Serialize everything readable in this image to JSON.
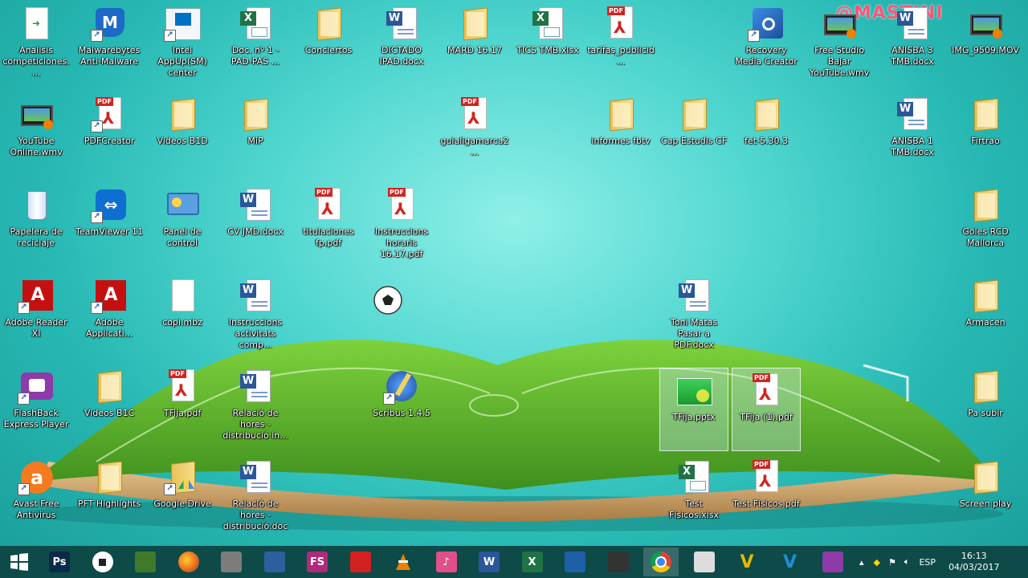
{
  "watermark": "@MASTINI",
  "desktop_icons": [
    {
      "label": "Analisis competiciones....",
      "type": "doc-generic"
    },
    {
      "label": "Malwarebytes Anti-Malware",
      "type": "malwarebytes"
    },
    {
      "label": "Intel AppUp(SM) center",
      "type": "intel"
    },
    {
      "label": "Doc. nº 1 - PAD-PAS ...",
      "type": "excel"
    },
    {
      "label": "Conciertos",
      "type": "folder"
    },
    {
      "label": "DICTADO IPAD.docx",
      "type": "word"
    },
    {
      "label": "MARD 16.17",
      "type": "folder"
    },
    {
      "label": "TICS TMB.xlsx",
      "type": "excel"
    },
    {
      "label": "tarifas_publicid...",
      "type": "pdf"
    },
    {
      "label": "Recovery Media Creator",
      "type": "recovery"
    },
    {
      "label": "Free Studio Bajar YouTube.wmv",
      "type": "video"
    },
    {
      "label": "ANISBA 3 TMB.docx",
      "type": "word"
    },
    {
      "label": "IMG_9509.MOV",
      "type": "video"
    },
    {
      "label": "YouTube Online.wmv",
      "type": "video"
    },
    {
      "label": "PDFCreator",
      "type": "pdfcreator"
    },
    {
      "label": "Videos B1D",
      "type": "folder"
    },
    {
      "label": "MiP",
      "type": "folder"
    },
    {
      "label": "guialigamarca2...",
      "type": "pdf"
    },
    {
      "label": "informes fbtv",
      "type": "folder"
    },
    {
      "label": "Cap Estudis CF",
      "type": "folder"
    },
    {
      "label": "fet-5.30.3",
      "type": "folder"
    },
    {
      "label": "ANISBA 1 TMB.docx",
      "type": "word"
    },
    {
      "label": "Firtrao",
      "type": "folder"
    },
    {
      "label": "Papelera de reciclaje",
      "type": "recycle"
    },
    {
      "label": "TeamViewer 11",
      "type": "teamviewer"
    },
    {
      "label": "Panel de control",
      "type": "control"
    },
    {
      "label": "CV JMD.docx",
      "type": "word"
    },
    {
      "label": "titulaciones fp.pdf",
      "type": "pdf"
    },
    {
      "label": "Instruccions horaris 16.17.pdf",
      "type": "pdf"
    },
    {
      "label": "Goles RCD Mallorca",
      "type": "folder"
    },
    {
      "label": "Adobe Reader XI",
      "type": "adobe"
    },
    {
      "label": "Adobe Applicati...",
      "type": "adobe"
    },
    {
      "label": "copi.mbz",
      "type": "blank"
    },
    {
      "label": "Instruccions activitats comp...",
      "type": "word"
    },
    {
      "label": "Toni Matas Pasar a PDF.docx",
      "type": "word"
    },
    {
      "label": "Armacen",
      "type": "folder"
    },
    {
      "label": "FlashBack Express Player",
      "type": "flashback"
    },
    {
      "label": "Videos B1C",
      "type": "folder"
    },
    {
      "label": "TFija.pdf",
      "type": "pdf"
    },
    {
      "label": "Relació de hores - distribució in...",
      "type": "word"
    },
    {
      "label": "Scribus 1.4.5",
      "type": "scribus"
    },
    {
      "label": "TFija.pptx",
      "type": "pptx"
    },
    {
      "label": "TFija (1).pdf",
      "type": "pdf"
    },
    {
      "label": "Pa subir",
      "type": "folder"
    },
    {
      "label": "Avast Free Antivirus",
      "type": "avast"
    },
    {
      "label": "PFT Highlights",
      "type": "folder"
    },
    {
      "label": "Google Drive",
      "type": "gdrive"
    },
    {
      "label": "Relació de hores - distribució.doc",
      "type": "word"
    },
    {
      "label": "Test Físicos.xlsx",
      "type": "excel"
    },
    {
      "label": "Test Físicos.pdf",
      "type": "pdf"
    },
    {
      "label": "Screen play",
      "type": "folder"
    }
  ],
  "taskbar": {
    "start_icon": "windows-logo-icon",
    "apps": [
      {
        "name": "photoshop",
        "text": "Ps",
        "color": "#0a2a4a"
      },
      {
        "name": "soccer-ball",
        "text": "",
        "color": "#ffffff"
      },
      {
        "name": "tactics-board",
        "text": "",
        "color": "#3f7a2a"
      },
      {
        "name": "firefox",
        "text": "",
        "color": "#e8661b"
      },
      {
        "name": "archive",
        "text": "",
        "color": "#7c7c7c"
      },
      {
        "name": "remote-desktop",
        "text": "",
        "color": "#2c5f9e"
      },
      {
        "name": "fs-app",
        "text": "FS",
        "color": "#b02a7a"
      },
      {
        "name": "media-app",
        "text": "",
        "color": "#d32020"
      },
      {
        "name": "vlc",
        "text": "",
        "color": "#f08000"
      },
      {
        "name": "itunes",
        "text": "♪",
        "color": "#e04f8a"
      },
      {
        "name": "word",
        "text": "W",
        "color": "#2b579a"
      },
      {
        "name": "excel",
        "text": "X",
        "color": "#217346"
      },
      {
        "name": "scribus",
        "text": "",
        "color": "#1f5fa8"
      },
      {
        "name": "color-app",
        "text": "",
        "color": "#333333"
      },
      {
        "name": "chrome",
        "text": "",
        "color": "#ffffff"
      },
      {
        "name": "notepad",
        "text": "",
        "color": "#dddddd"
      },
      {
        "name": "vegas",
        "text": "V",
        "color": "#e8b800"
      },
      {
        "name": "vegas-blue",
        "text": "V",
        "color": "#1f8fd8"
      },
      {
        "name": "flashback",
        "text": "",
        "color": "#8e3aa8"
      }
    ],
    "tray": {
      "language": "ESP",
      "time": "16:13",
      "date": "04/03/2017"
    }
  }
}
